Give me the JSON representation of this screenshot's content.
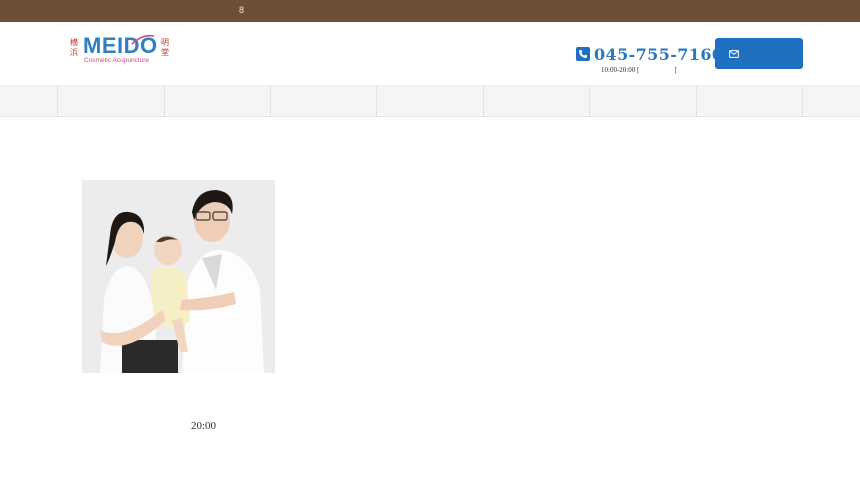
{
  "topbar": {
    "text": "8"
  },
  "logo": {
    "kanji_left": "横浜",
    "word": "MEIDO",
    "sub": "Cosmetic Acupuncture",
    "kanji_right": "明堂"
  },
  "header": {
    "phone_number": "045-755-7160",
    "hours": "10:00-20:00 [                    ]",
    "contact_icon": "envelope-icon",
    "phone_icon": "phone-icon"
  },
  "nav": {
    "item_count": 8
  },
  "colors": {
    "topbar": "#6e4e35",
    "accent_blue": "#1f70c1",
    "logo_pink": "#d04a86",
    "nav_bg": "#f6f5f3"
  },
  "main": {
    "photo_icon": "family-photo",
    "closing_time": "20:00"
  }
}
